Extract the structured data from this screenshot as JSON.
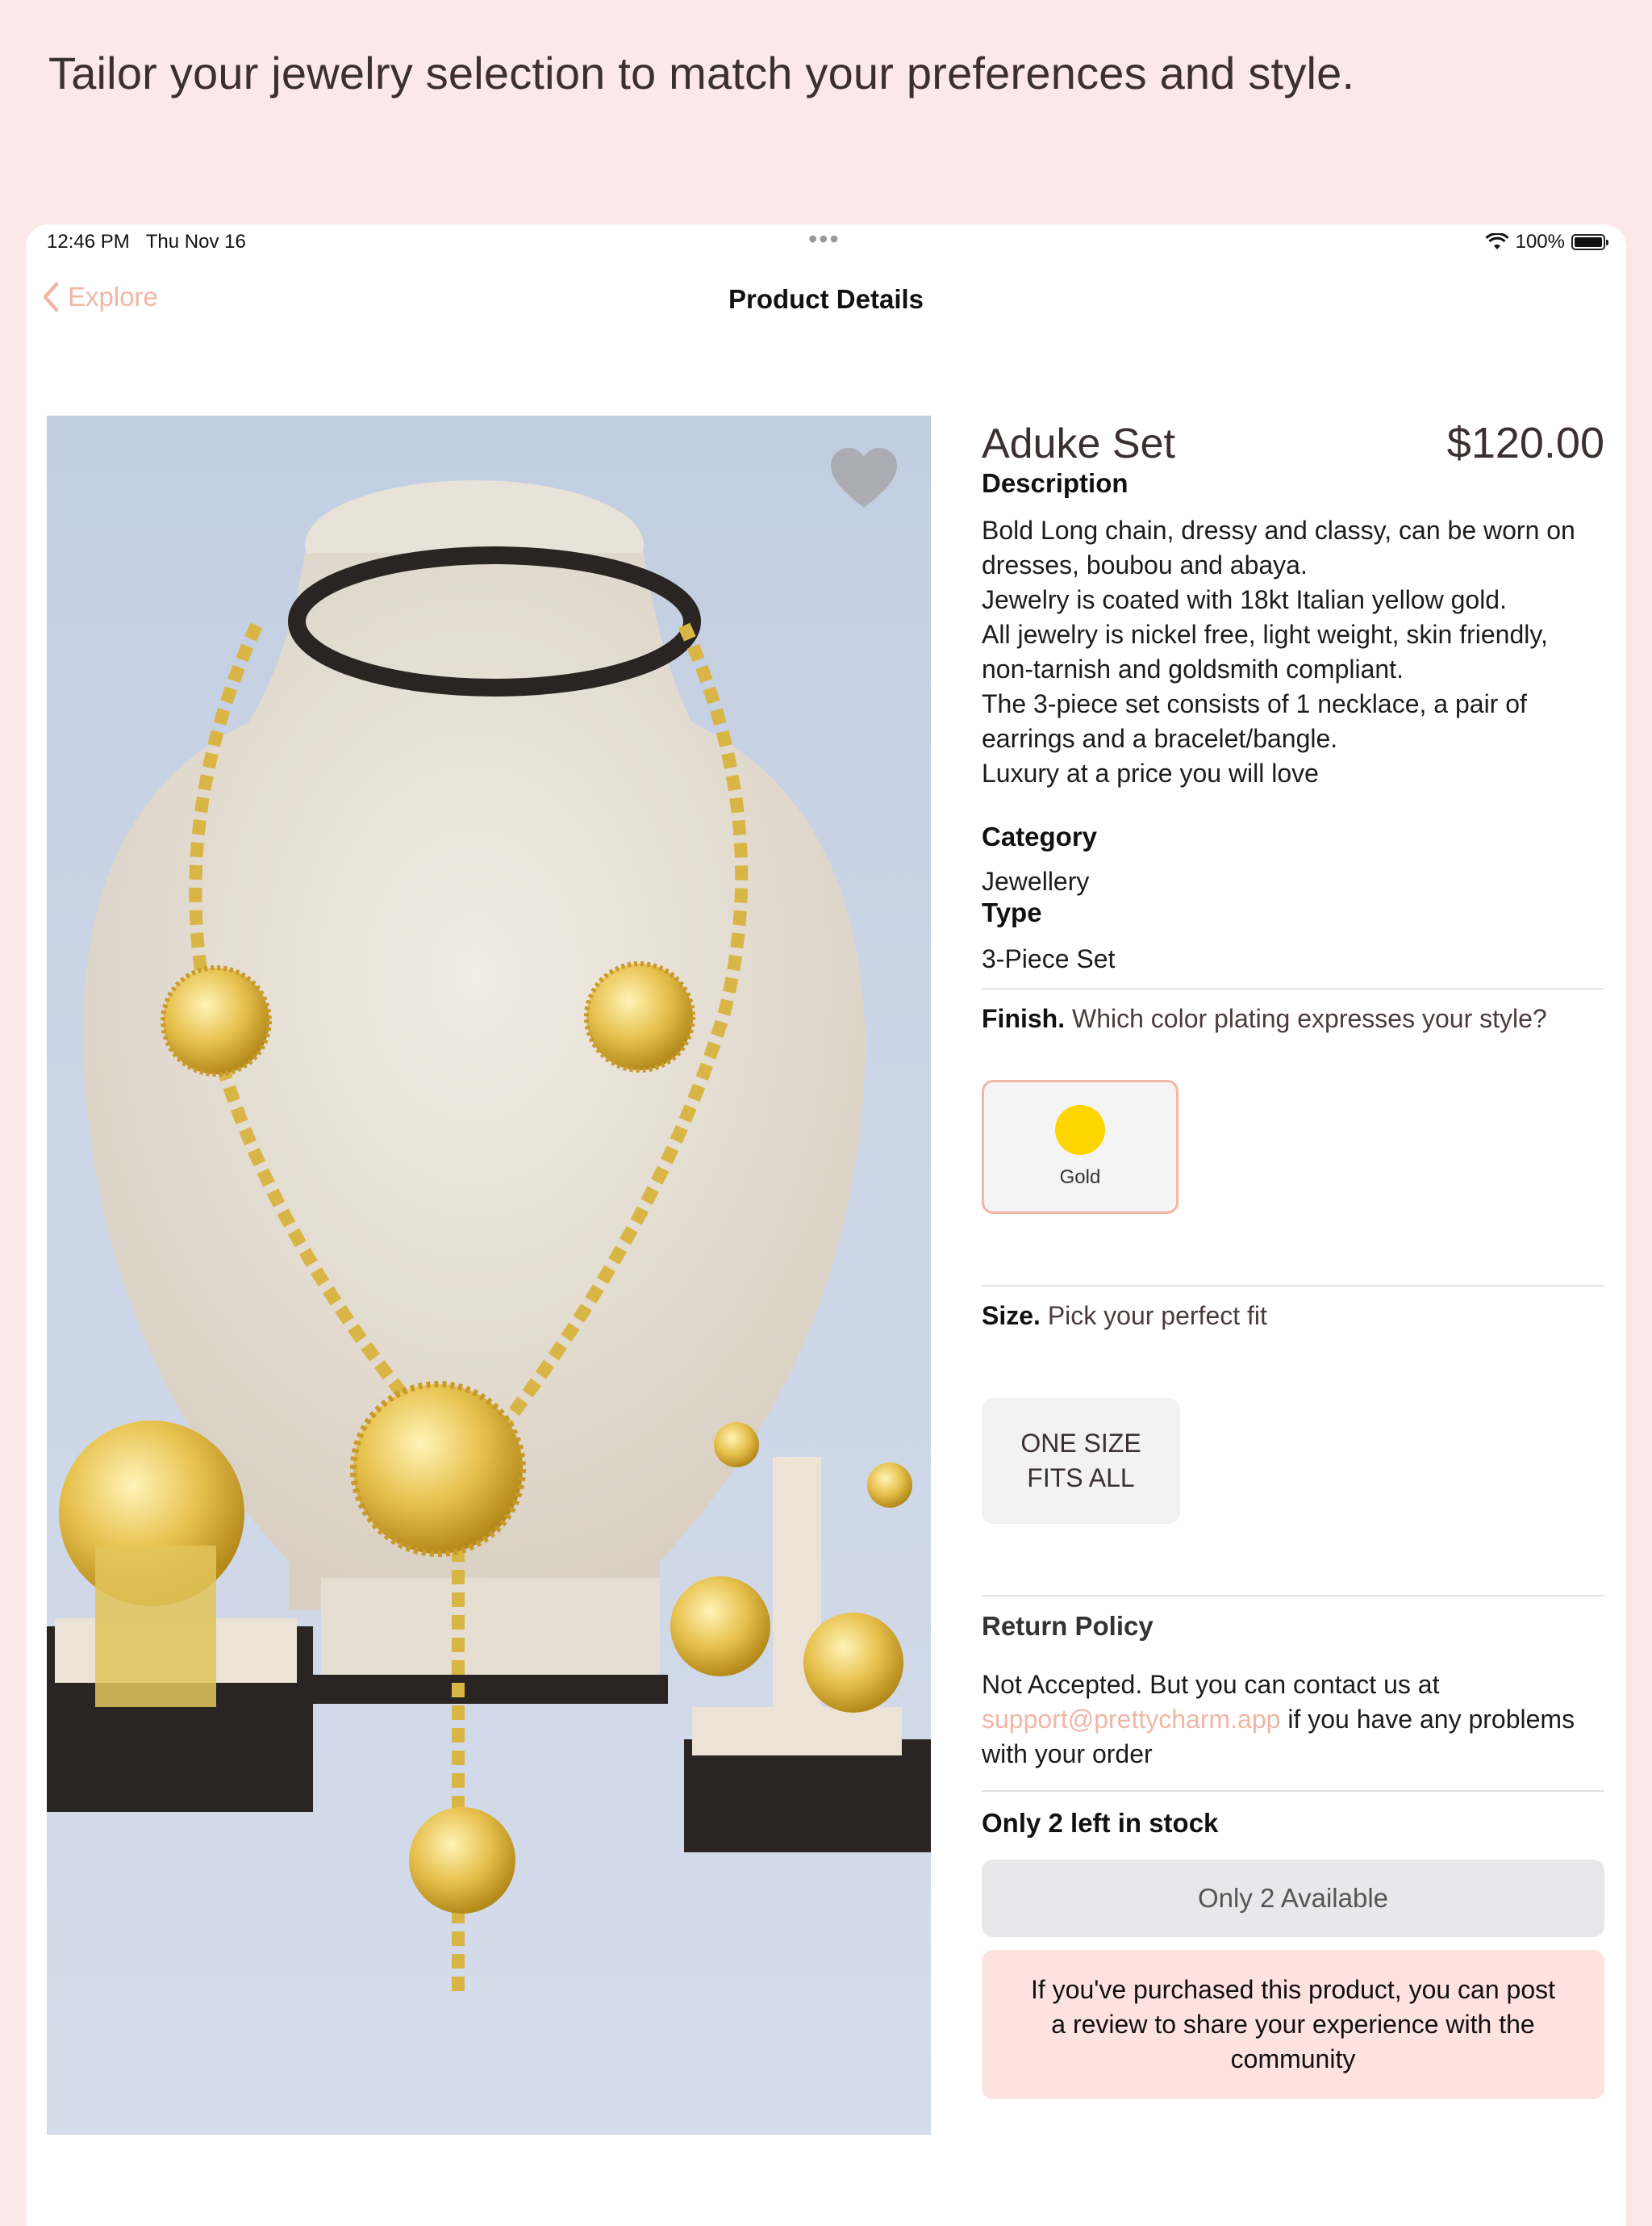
{
  "headline": "Tailor your jewelry selection to match your preferences and style.",
  "status_bar": {
    "time": "12:46 PM",
    "date": "Thu Nov 16",
    "battery": "100%"
  },
  "nav": {
    "back_label": "Explore",
    "title": "Product Details"
  },
  "product": {
    "name": "Aduke Set",
    "price": "$120.00",
    "description_label": "Description",
    "description_lines": [
      "Bold Long chain, dressy and classy, can be worn on",
      "dresses, boubou and abaya.",
      "Jewelry is coated with 18kt Italian yellow gold.",
      "All jewelry is nickel free, light weight, skin friendly,",
      "non-tarnish and goldsmith compliant.",
      "The 3-piece set consists of 1 necklace, a pair of",
      "earrings and a bracelet/bangle.",
      "Luxury at a price you will love"
    ],
    "category_label": "Category",
    "category_value": "Jewellery",
    "type_label": "Type",
    "type_value": "3-Piece Set"
  },
  "finish": {
    "label": "Finish.",
    "prompt": "Which color plating expresses your style?",
    "options": [
      {
        "label": "Gold",
        "color": "#ffd500",
        "selected": true
      }
    ]
  },
  "size": {
    "label": "Size.",
    "prompt": "Pick your perfect fit",
    "option_line1": "ONE SIZE",
    "option_line2": "FITS ALL"
  },
  "return_policy": {
    "title": "Return Policy",
    "line1": "Not Accepted. But you can contact us at",
    "email": "support@prettycharm.app",
    "line2_suffix": " if you have any problems",
    "line3": "with your order"
  },
  "stock": {
    "title": "Only 2 left in stock",
    "button": "Only 2 Available"
  },
  "review": {
    "line1": "If you've purchased this product, you can post",
    "line2": "a review to share your experience with the",
    "line3": "community"
  },
  "colors": {
    "accent": "#f1b6a6",
    "background": "#fde8e8",
    "swatch_gold": "#ffd500"
  }
}
